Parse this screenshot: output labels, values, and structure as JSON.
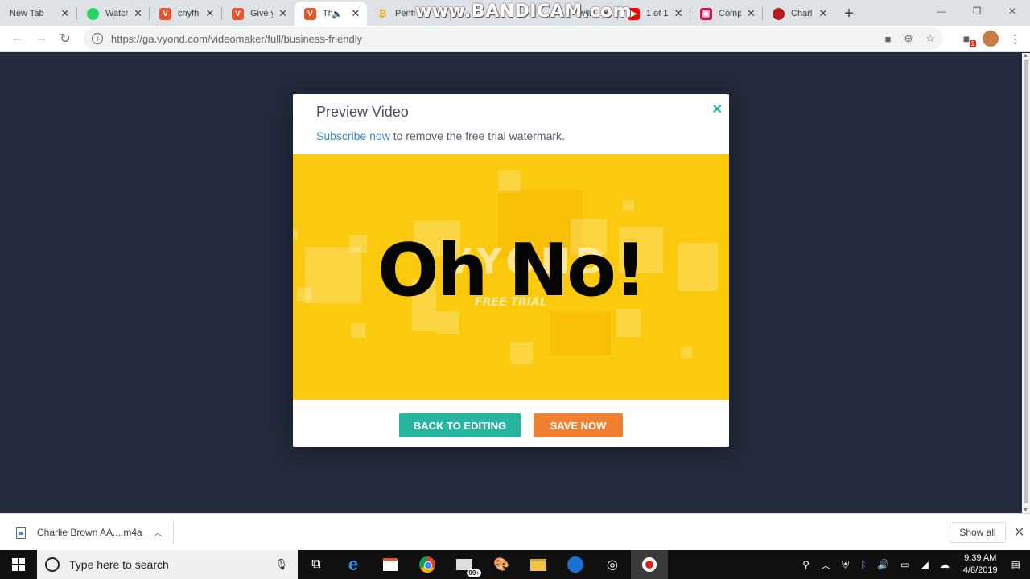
{
  "browser": {
    "tabs": [
      {
        "title": "New Tab",
        "icon": "none",
        "active": false
      },
      {
        "title": "Watch",
        "icon": "whatsapp-icon",
        "active": false
      },
      {
        "title": "chyfh",
        "icon": "vyond-icon",
        "active": false
      },
      {
        "title": "Give y",
        "icon": "vyond-icon",
        "active": false
      },
      {
        "title": "Th",
        "icon": "vyond-icon",
        "active": true
      },
      {
        "title": "Penfi",
        "icon": "coin-icon",
        "active": false
      },
      {
        "title": "will l",
        "icon": "none",
        "active": false
      },
      {
        "title": "1 of 1",
        "icon": "youtube-icon",
        "active": false
      },
      {
        "title": "Comp",
        "icon": "media-icon",
        "active": false
      },
      {
        "title": "Charl",
        "icon": "circle-icon",
        "active": false
      }
    ],
    "url": "https://ga.vyond.com/videomaker/full/business-friendly",
    "watermark": "www.BANDICAM.com"
  },
  "modal": {
    "title": "Preview Video",
    "subscribe_link": "Subscribe now",
    "subtitle_rest": " to remove the free trial watermark.",
    "video_text": "Oh No!",
    "watermark_brand": "VYOND",
    "watermark_sub": "FREE TRIAL",
    "back_button": "BACK TO EDITING",
    "save_button": "SAVE NOW",
    "colors": {
      "teal": "#26b6a0",
      "orange": "#f08030",
      "video_bg": "#fbca0e"
    }
  },
  "downloads": {
    "file_name": "Charlie Brown AA....m4a",
    "show_all": "Show all"
  },
  "taskbar": {
    "search_placeholder": "Type here to search",
    "mail_badge": "99+",
    "time": "9:39 AM",
    "date": "4/8/2019"
  }
}
